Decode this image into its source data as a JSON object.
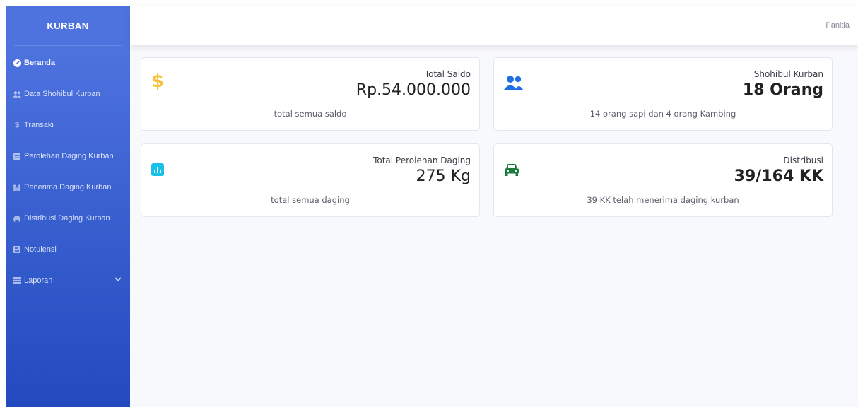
{
  "sidebar": {
    "brand": "KURBAN",
    "items": [
      {
        "label": "Beranda",
        "icon": "dashboard-icon"
      },
      {
        "label": "Data Shohibul Kurban",
        "icon": "users-icon"
      },
      {
        "label": "Transaki",
        "icon": "dollar-icon"
      },
      {
        "label": "Perolehan Daging Kurban",
        "icon": "calendar-icon"
      },
      {
        "label": "Penerima Daging Kurban",
        "icon": "people-icon"
      },
      {
        "label": "Distribusi Daging Kurban",
        "icon": "car-icon"
      },
      {
        "label": "Notulensi",
        "icon": "save-icon"
      },
      {
        "label": "Laporan",
        "icon": "table-icon"
      }
    ]
  },
  "topbar": {
    "user": "Panitia"
  },
  "cards": [
    {
      "title": "Total Saldo",
      "value": "Rp.54.000.000",
      "footer": "total semua saldo",
      "icon": "dollar-icon",
      "icon_color": "#f6c23e"
    },
    {
      "title": "Shohibul Kurban",
      "value": "18 Orang",
      "footer": "14 orang sapi dan 4 orang Kambing",
      "icon": "users-icon",
      "icon_color": "#1f6fe5"
    },
    {
      "title": "Total Perolehan Daging",
      "value": "275 Kg",
      "footer": "total semua daging",
      "icon": "chart-icon",
      "icon_color": "#17c1e8"
    },
    {
      "title": "Distribusi",
      "value": "39/164 KK",
      "footer": "39 KK telah menerima daging kurban",
      "icon": "car-icon",
      "icon_color": "#1c7a3d"
    }
  ],
  "colors": {
    "sidebar_top": "#4e73df",
    "sidebar_bottom": "#224abe",
    "background": "#f8f9fc"
  }
}
